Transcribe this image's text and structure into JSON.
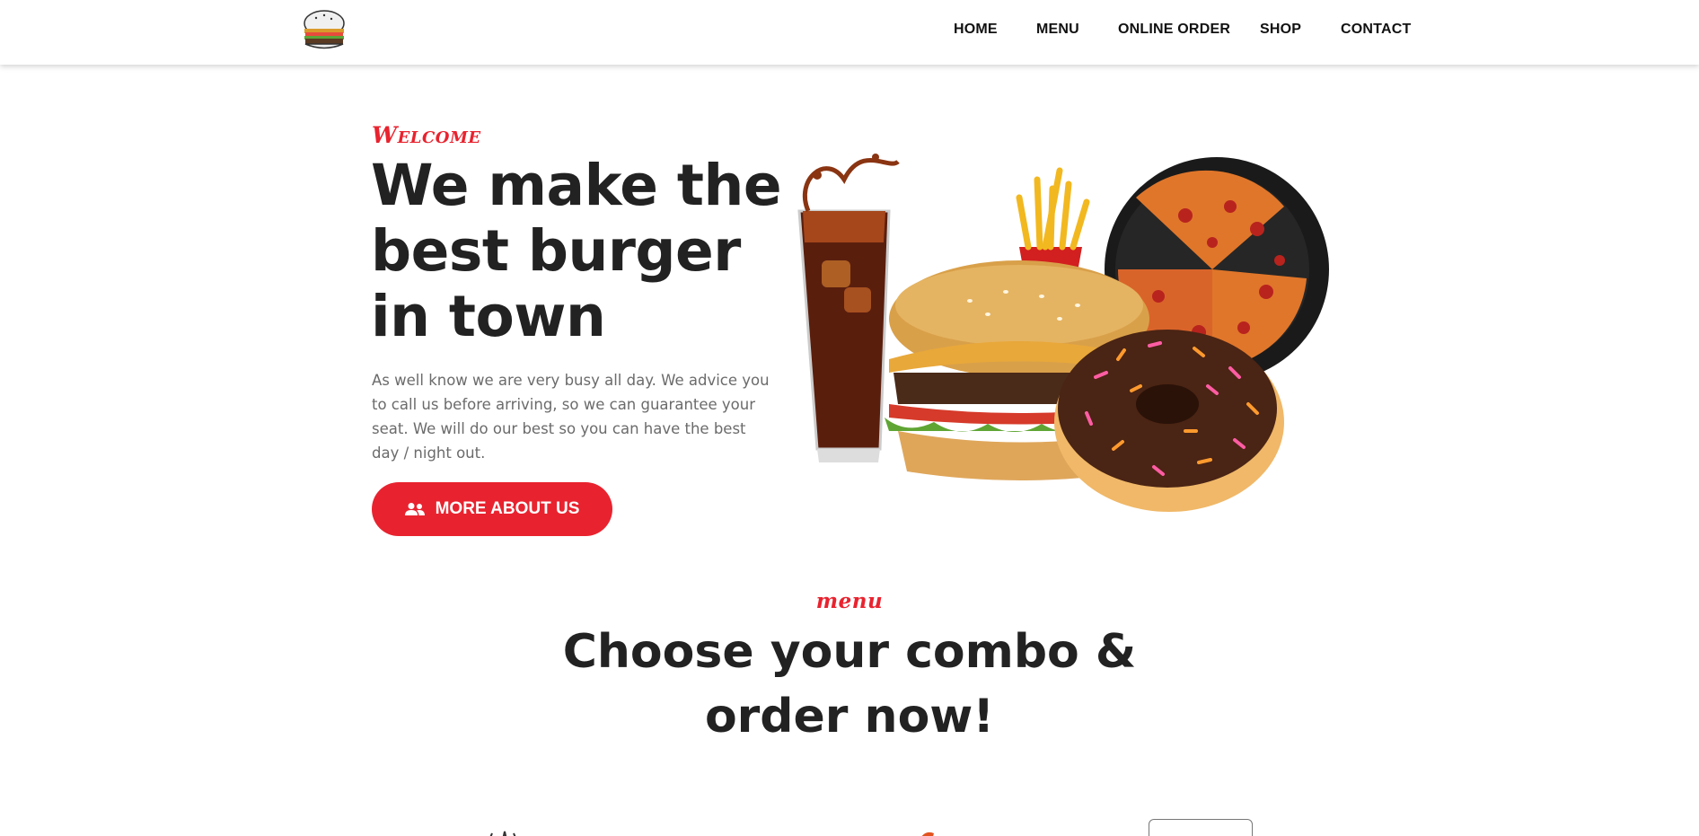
{
  "header": {
    "logo_icon": "burger-logo-icon",
    "nav": [
      "HOME",
      "MENU",
      "ONLINE ORDER",
      "SHOP",
      "CONTACT"
    ]
  },
  "hero": {
    "eyebrow": "Welcome",
    "title": "We make the best burger in town",
    "text": "As well know we are very busy all day. We advice you to call us before arriving, so we can guarantee your seat. We will do our best so you can have the best day / night out.",
    "button_label": "MORE ABOUT US",
    "button_icon": "users-icon",
    "image": "food-combo-illustration"
  },
  "menu": {
    "eyebrow": "menu",
    "title": "Choose your combo & order now!"
  },
  "colors": {
    "accent": "#e8232f",
    "heading": "#222222",
    "body_text": "#6b6b6b"
  }
}
